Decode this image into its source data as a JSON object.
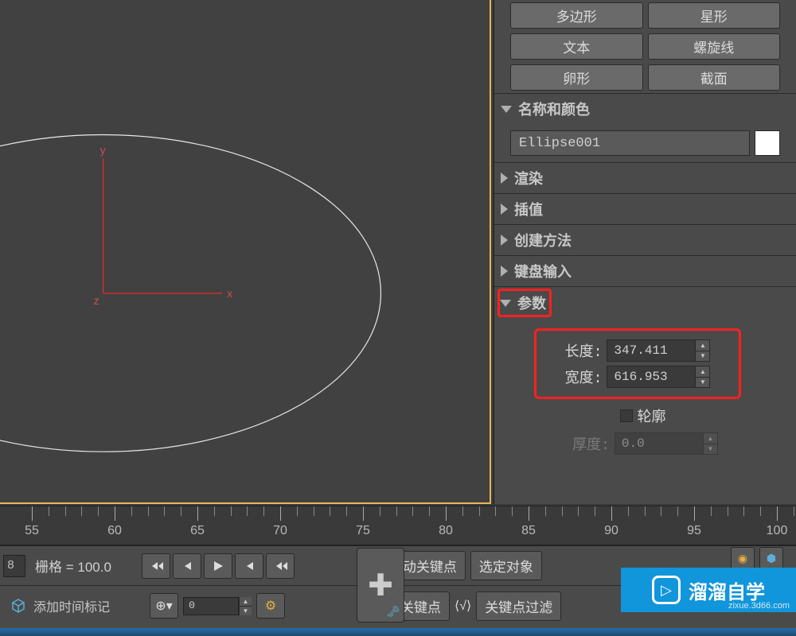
{
  "shapes": {
    "polygon": "多边形",
    "star": "星形",
    "text": "文本",
    "helix": "螺旋线",
    "egg": "卵形",
    "section": "截面"
  },
  "rollouts": {
    "name_color": "名称和颜色",
    "render": "渲染",
    "interpolation": "插值",
    "creation_method": "创建方法",
    "keyboard_entry": "键盘输入",
    "parameters": "参数"
  },
  "object_name": "Ellipse001",
  "params": {
    "length_label": "长度:",
    "length_value": "347.411",
    "width_label": "宽度:",
    "width_value": "616.953",
    "outline_label": "轮廓",
    "thickness_label": "厚度:",
    "thickness_value": "0.0"
  },
  "timeline": {
    "ticks": [
      55,
      60,
      65,
      70,
      75,
      80,
      85,
      90,
      95,
      100
    ]
  },
  "bottom": {
    "frame_cut": "8",
    "grid_label": "栅格 = 100.0",
    "time_marker": "添加时间标记",
    "auto_key": "自动关键点",
    "set_key": "设置关键点",
    "selected": "选定对象",
    "key_filter": "关键点过滤",
    "filter_icon": "⟨√⟩",
    "frame_value": "0"
  },
  "watermark": {
    "brand": "溜溜自学",
    "domain": "zixue.3d66.com"
  },
  "axis": {
    "x": "x",
    "y": "y",
    "z": "z"
  }
}
